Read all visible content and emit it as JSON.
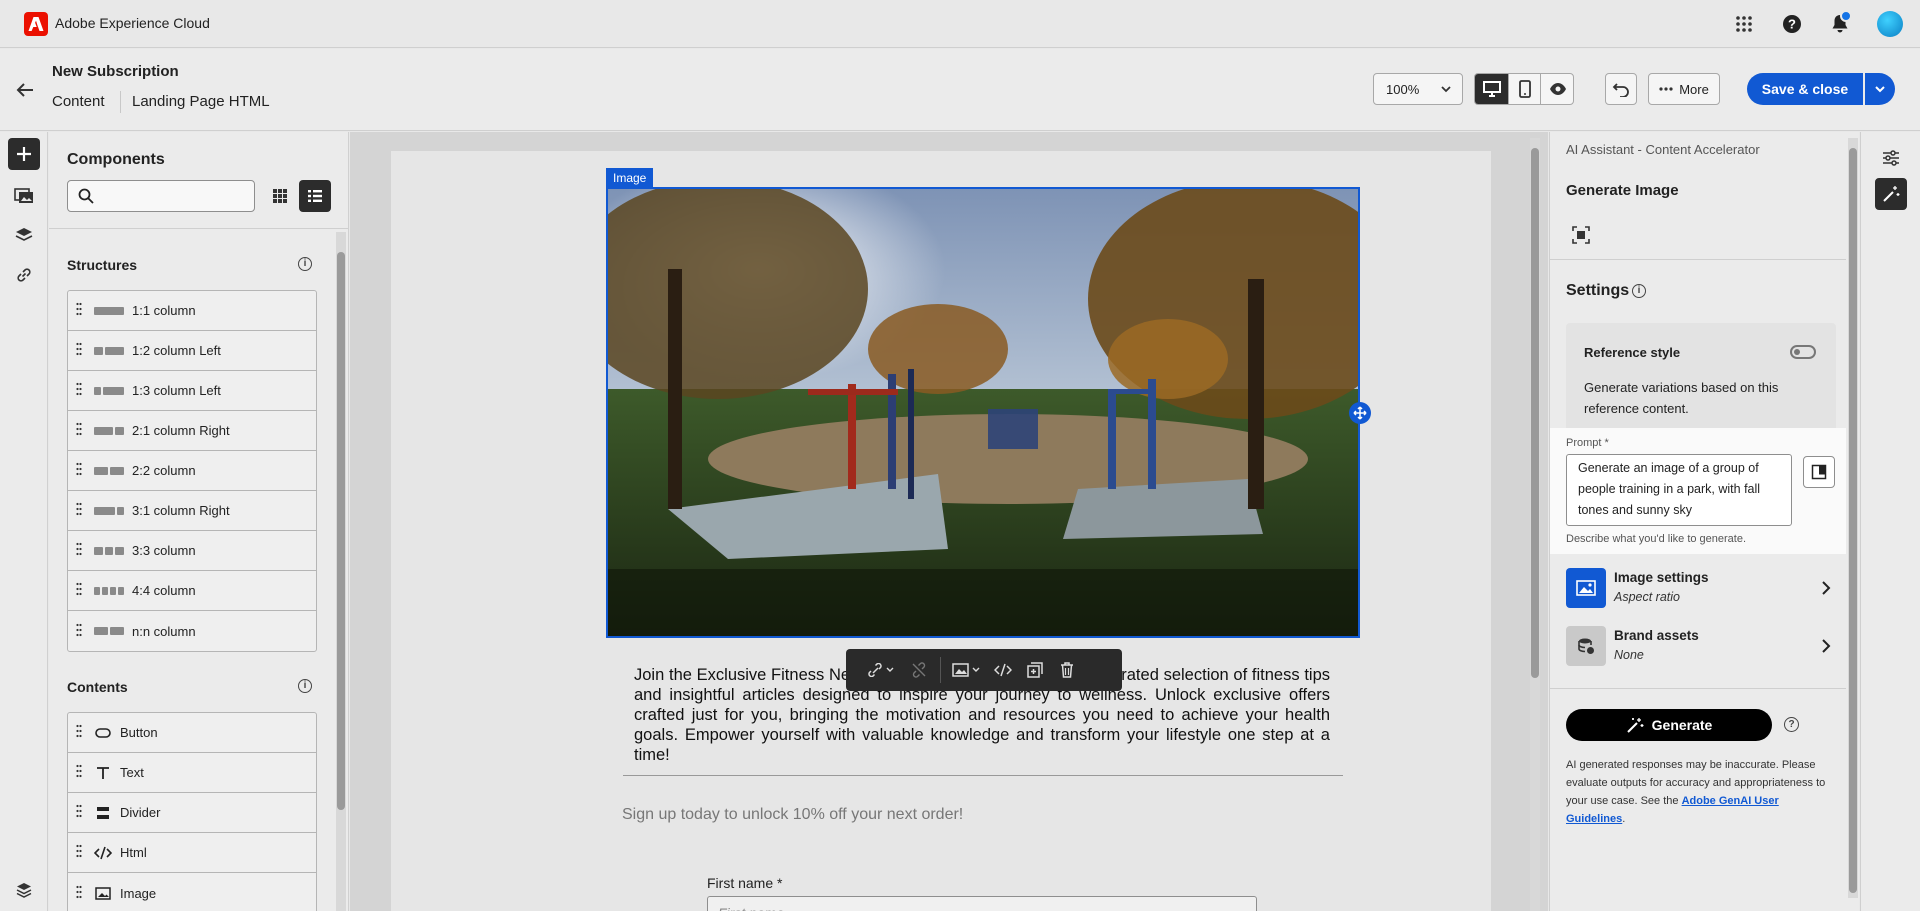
{
  "topbar": {
    "app_title": "Adobe Experience Cloud",
    "icons": [
      "adobe-logo",
      "apps-grid-icon",
      "help-icon",
      "bell-icon",
      "avatar"
    ]
  },
  "header": {
    "title": "New Subscription",
    "breadcrumb": [
      "Content",
      "Landing Page HTML"
    ],
    "zoom": "100%",
    "more_label": "More",
    "save_label": "Save & close"
  },
  "components": {
    "title": "Components",
    "search_placeholder": "",
    "structures_title": "Structures",
    "structures": [
      {
        "label": "1:1 column",
        "cols": [
          4
        ]
      },
      {
        "label": "1:2 column Left",
        "cols": [
          1,
          2
        ]
      },
      {
        "label": "1:3 column Left",
        "cols": [
          1,
          3
        ]
      },
      {
        "label": "2:1 column Right",
        "cols": [
          2,
          1
        ]
      },
      {
        "label": "2:2 column",
        "cols": [
          1,
          1
        ]
      },
      {
        "label": "3:1 column Right",
        "cols": [
          3,
          1
        ]
      },
      {
        "label": "3:3 column",
        "cols": [
          1,
          1,
          1
        ]
      },
      {
        "label": "4:4 column",
        "cols": [
          1,
          1,
          1,
          1
        ]
      },
      {
        "label": "n:n column",
        "cols": [
          1,
          1
        ]
      }
    ],
    "contents_title": "Contents",
    "contents": [
      {
        "label": "Button",
        "icon": "button-icon"
      },
      {
        "label": "Text",
        "icon": "text-icon"
      },
      {
        "label": "Divider",
        "icon": "divider-icon"
      },
      {
        "label": "Html",
        "icon": "html-icon"
      },
      {
        "label": "Image",
        "icon": "image-icon"
      }
    ]
  },
  "canvas": {
    "image_label": "Image",
    "body_text": "Join the Exclusive Fitness Newsletter! Our newsletter delivers a curated selection of fitness tips and insightful articles designed to inspire your journey to wellness. Unlock exclusive offers crafted just for you, bringing the motivation and resources you need to achieve your health goals. Empower yourself with valuable knowledge and transform your lifestyle one step at a time!",
    "promo": "Sign up today to unlock 10% off your next order!",
    "first_name_label": "First name *",
    "first_name_placeholder": "First name"
  },
  "ai_panel": {
    "subtitle": "AI Assistant - Content Accelerator",
    "title": "Generate Image",
    "settings_title": "Settings",
    "reference_style_title": "Reference style",
    "reference_style_desc": "Generate variations based on this reference content.",
    "prompt_label": "Prompt *",
    "prompt_value": "Generate an image of a group of people training in a park, with fall tones and sunny sky",
    "prompt_help": "Describe what you'd like to generate.",
    "image_settings_title": "Image settings",
    "image_settings_sub": "Aspect ratio",
    "brand_assets_title": "Brand assets",
    "brand_assets_sub": "None",
    "generate_label": "Generate",
    "disclaimer": "AI generated responses may be inaccurate. Please evaluate outputs for accuracy and appropriateness to your use case. See the ",
    "disclaimer_link": "Adobe GenAI User Guidelines",
    "disclaimer_end": "."
  },
  "colors": {
    "accent": "#1159d3",
    "adobe_red": "#eb1000",
    "dark": "#2c2c2c"
  }
}
